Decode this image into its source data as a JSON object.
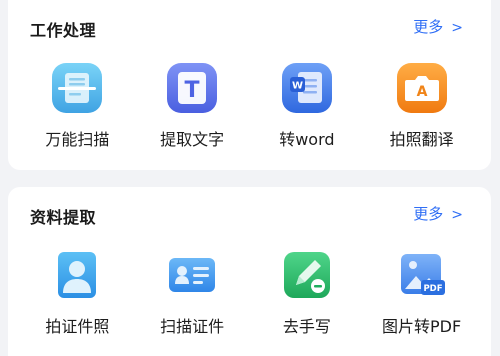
{
  "sections": [
    {
      "title": "工作处理",
      "more": "更多",
      "more_icon": "chevron-right",
      "tools": [
        {
          "label": "万能扫描",
          "icon": "scan-icon"
        },
        {
          "label": "提取文字",
          "icon": "text-extract-icon"
        },
        {
          "label": "转word",
          "icon": "word-icon"
        },
        {
          "label": "拍照翻译",
          "icon": "photo-translate-icon"
        }
      ]
    },
    {
      "title": "资料提取",
      "more": "更多",
      "more_icon": "chevron-right",
      "tools": [
        {
          "label": "拍证件照",
          "icon": "id-photo-icon"
        },
        {
          "label": "扫描证件",
          "icon": "id-card-scan-icon"
        },
        {
          "label": "去手写",
          "icon": "remove-handwriting-icon"
        },
        {
          "label": "图片转PDF",
          "icon": "image-to-pdf-icon"
        }
      ]
    }
  ],
  "colors": {
    "accent": "#2f6ef5",
    "scan": "#4fb6e8",
    "text": "#5b72e6",
    "word": "#3b79e8",
    "translate": "#f28a1c",
    "idphoto": "#3aa6ec",
    "idcard": "#3f9ff0",
    "handwriting": "#27bf6a",
    "pdf": "#4c8ff0"
  }
}
